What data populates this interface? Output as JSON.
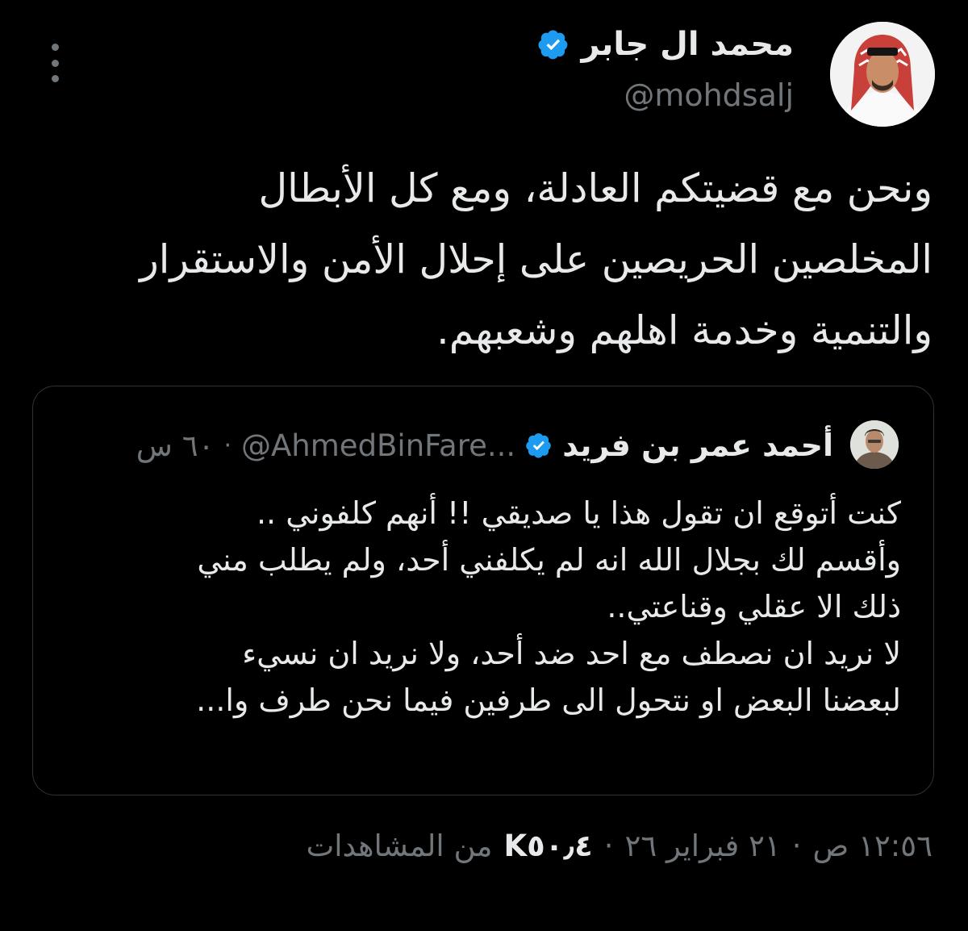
{
  "author": {
    "display_name": "محمد ال جابر",
    "handle": "@mohdsalj",
    "verified": true,
    "avatar_icon": "avatar-photo"
  },
  "tweet": {
    "text": "ونحن مع قضيتكم العادلة، ومع كل الأبطال\nالمخلصين الحريصين على إحلال الأمن والاستقرار\nوالتنمية وخدمة اهلهم وشعبهم."
  },
  "quote": {
    "display_name": "أحمد عمر بن فريد",
    "handle": "@AhmedBinFare...",
    "separator": "·",
    "time": "٦٠ س",
    "verified": true,
    "text": "كنت أتوقع ان تقول هذا يا صديقي !! أنهم كلفوني  ..\nوأقسم لك بجلال الله انه لم يكلفني أحد،  ولم يطلب مني\nذلك الا عقلي وقناعتي..\nلا نريد ان نصطف مع احد ضد أحد،  ولا نريد ان نسيء\nلبعضنا البعض او نتحول الى طرفين فيما نحن طرف وا..."
  },
  "meta": {
    "time": "١٢:٥٦ ص",
    "date": "٢١ فبراير ٢٦",
    "views": "K٥٠٫٤",
    "views_label": "من المشاهدات",
    "separator": "·"
  },
  "colors": {
    "background": "#000000",
    "text": "#e7e9ea",
    "muted": "#71767b",
    "border": "#2f3336",
    "verified_blue": "#1d9bf0"
  }
}
